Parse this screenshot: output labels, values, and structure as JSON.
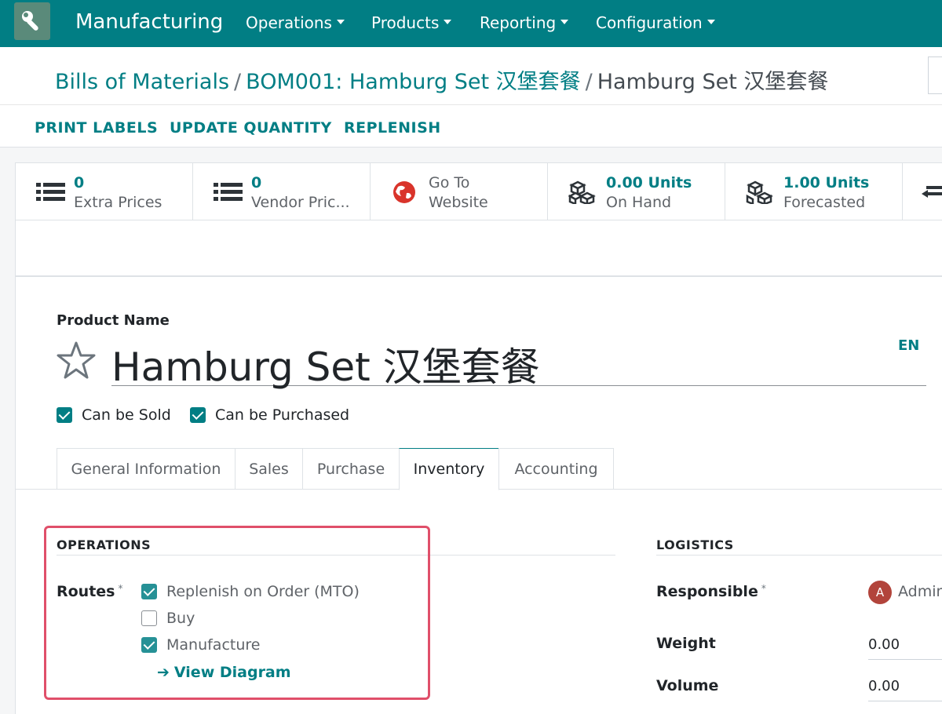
{
  "navbar": {
    "app_name": "Manufacturing",
    "menus": [
      "Operations",
      "Products",
      "Reporting",
      "Configuration"
    ]
  },
  "breadcrumb": {
    "items": [
      "Bills of Materials",
      "BOM001: Hamburg Set 汉堡套餐"
    ],
    "current": "Hamburg Set 汉堡套餐",
    "separator": "/"
  },
  "actions": [
    "PRINT LABELS",
    "UPDATE QUANTITY",
    "REPLENISH"
  ],
  "smart_buttons": [
    {
      "value": "0",
      "label": "Extra Prices",
      "icon": "list-icon"
    },
    {
      "value": "0",
      "label": "Vendor Pric...",
      "icon": "list-icon"
    },
    {
      "value": "Go To",
      "label": "Website",
      "icon": "globe-icon"
    },
    {
      "value": "0.00 Units",
      "label": "On Hand",
      "icon": "cubes-icon"
    },
    {
      "value": "1.00 Units",
      "label": "Forecasted",
      "icon": "cubes-icon"
    }
  ],
  "product": {
    "name_label": "Product Name",
    "name": "Hamburg Set 汉堡套餐",
    "lang": "EN",
    "can_be_sold": {
      "label": "Can be Sold",
      "checked": true
    },
    "can_be_purchased": {
      "label": "Can be Purchased",
      "checked": true
    }
  },
  "tabs": [
    {
      "label": "General Information",
      "active": false
    },
    {
      "label": "Sales",
      "active": false
    },
    {
      "label": "Purchase",
      "active": false
    },
    {
      "label": "Inventory",
      "active": true
    },
    {
      "label": "Accounting",
      "active": false
    }
  ],
  "operations": {
    "title": "OPERATIONS",
    "routes_label": "Routes",
    "required_mark": "*",
    "routes": [
      {
        "label": "Replenish on Order (MTO)",
        "checked": true
      },
      {
        "label": "Buy",
        "checked": false
      },
      {
        "label": "Manufacture",
        "checked": true
      }
    ],
    "diagram_link": "View Diagram"
  },
  "logistics": {
    "title": "LOGISTICS",
    "responsible_label": "Responsible",
    "required_mark": "*",
    "responsible_initial": "A",
    "responsible_value": "Admin",
    "weight_label": "Weight",
    "weight_value": "0.00",
    "volume_label": "Volume",
    "volume_value": "0.00"
  },
  "colors": {
    "brand": "#017e84",
    "highlight": "#e04f6a",
    "avatar": "#b2443b"
  }
}
